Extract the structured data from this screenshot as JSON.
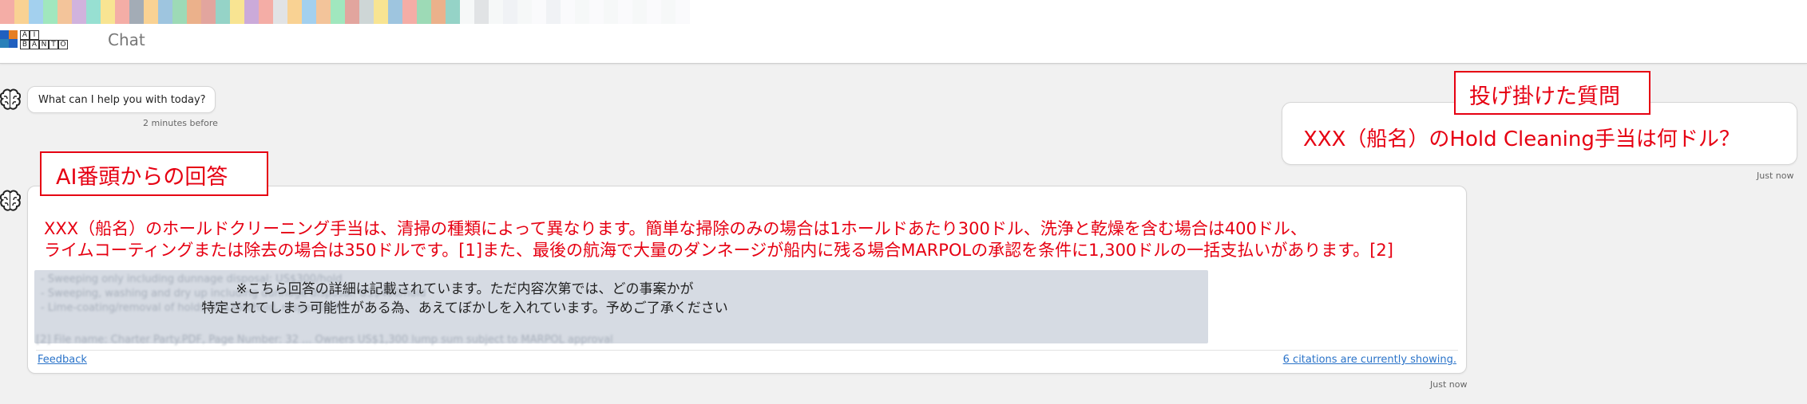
{
  "header": {
    "logo_text": [
      "A",
      "I",
      "B",
      "A",
      "N",
      "T",
      "O"
    ],
    "title": "Chat"
  },
  "colors": {
    "annotation_red": "#e60012",
    "link_blue": "#2a73c9",
    "background": "#f1f1f1"
  },
  "icons": {
    "avatar": "brain-icon"
  },
  "messages": {
    "greeting": {
      "text": "What can I help you with today?",
      "time": "2 minutes before"
    },
    "question": {
      "text": "XXX（船名）のHold Cleaning手当は何ドル？",
      "time": "Just now"
    },
    "answer": {
      "line1": "XXX（船名）のホールドクリーニング手当は、清掃の種類によって異なります。簡単な掃除のみの場合は1ホールドあたり300ドル、洗浄と乾燥を含む場合は400ドル、",
      "line2": "ライムコーティングまたは除去の場合は350ドルです。[1]また、最後の航海で大量のダンネージが船内に残る場合MARPOLの承認を条件に1,300ドルの一括支払いがあります。[2]",
      "blurred_line1": "- Sweeping only including dunnage disposal: US$300/hold",
      "blurred_line2": "- Sweeping, washing and dry up including dunnage disposal: US$400/hold",
      "blurred_line3": "- Lime-coating/removal of holds US$350/hold, respectively",
      "blurred_ref": "[2] File name: Charter Party.PDF, Page Number: 32 ... Owners US$1,300 lump sum subject to MARPOL approval",
      "notice_line1": "※こちら回答の詳細は記載されています。ただ内容次第では、どの事案かが",
      "notice_line2": "特定されてしまう可能性がある為、あえてぼかしを入れています。予めご了承ください",
      "feedback": "Feedback",
      "citations": "6 citations are currently showing.",
      "time": "Just now"
    }
  },
  "annotations": {
    "question_label": "投げ掛けた質問",
    "answer_label": "AI番頭からの回答"
  }
}
